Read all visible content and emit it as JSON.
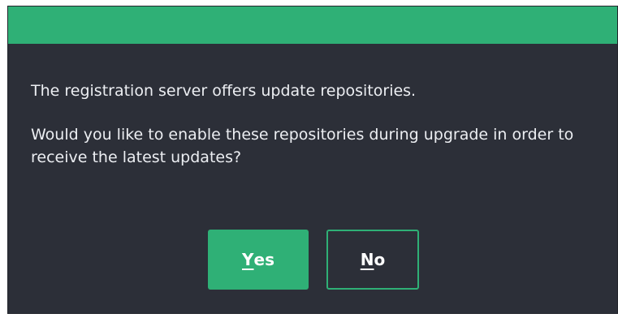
{
  "dialog": {
    "message_line1": "The registration server offers update repositories.",
    "message_line2": "Would you like to enable these repositories during upgrade in order to receive the latest updates?",
    "buttons": {
      "yes": {
        "accel": "Y",
        "rest": "es"
      },
      "no": {
        "accel": "N",
        "rest": "o"
      }
    }
  },
  "colors": {
    "accent": "#2fb076",
    "dialog_bg": "#2c2f38",
    "text": "#eceef2"
  }
}
